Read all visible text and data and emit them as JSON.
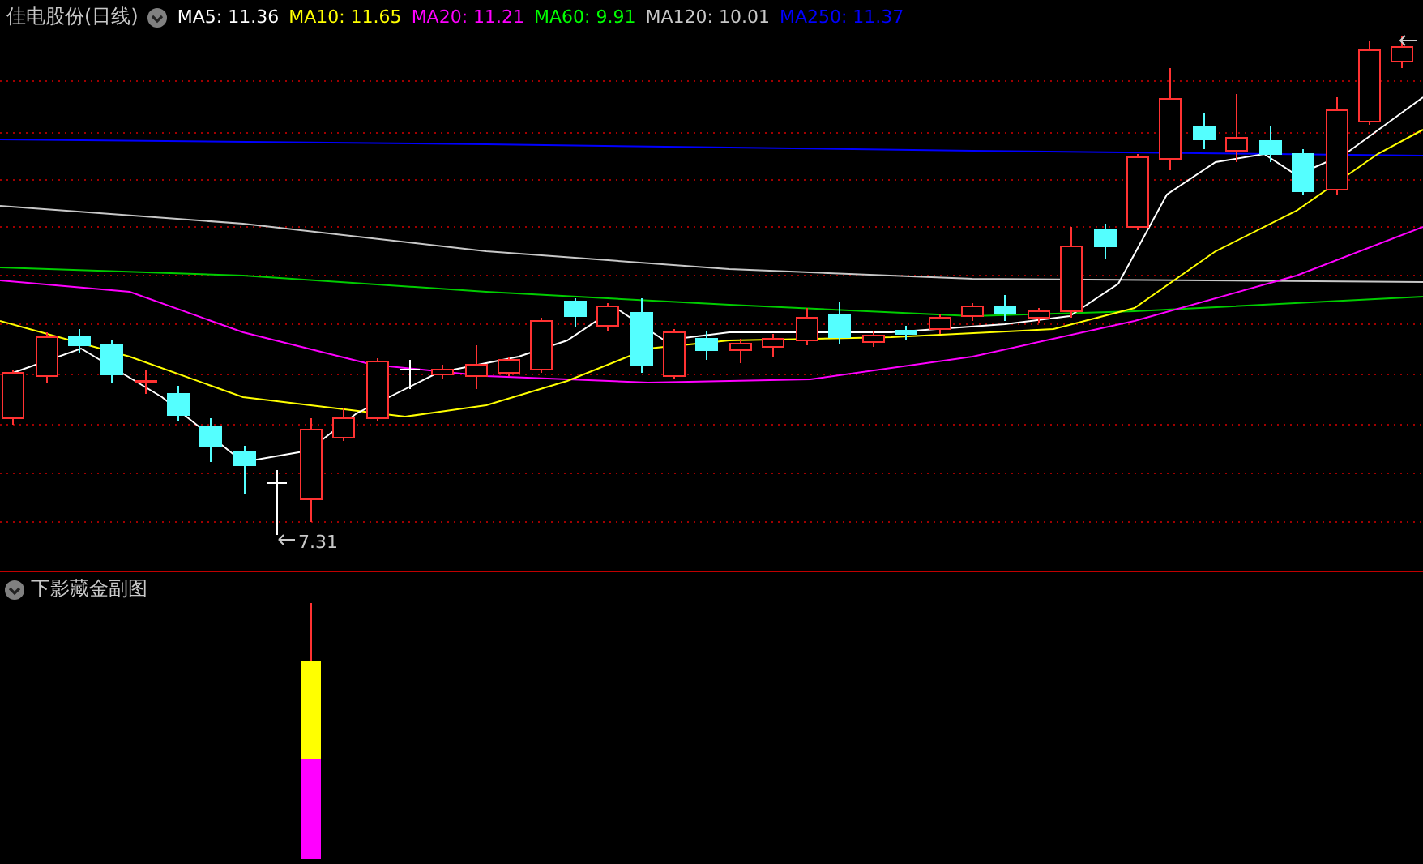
{
  "main_chart": {
    "title": "佳电股份(日线)",
    "indicators": [
      {
        "label": "MA5: 11.36",
        "color": "#ffffff"
      },
      {
        "label": "MA10: 11.65",
        "color": "#ffff00"
      },
      {
        "label": "MA20: 11.21",
        "color": "#ff00ff"
      },
      {
        "label": "MA60: 9.91",
        "color": "#00ff00"
      },
      {
        "label": "MA120: 10.01",
        "color": "#c8c8c8"
      },
      {
        "label": "MA250: 11.37",
        "color": "#0000ff"
      }
    ],
    "low_label": "7.31"
  },
  "sub_chart": {
    "title": "下影藏金副图"
  }
}
